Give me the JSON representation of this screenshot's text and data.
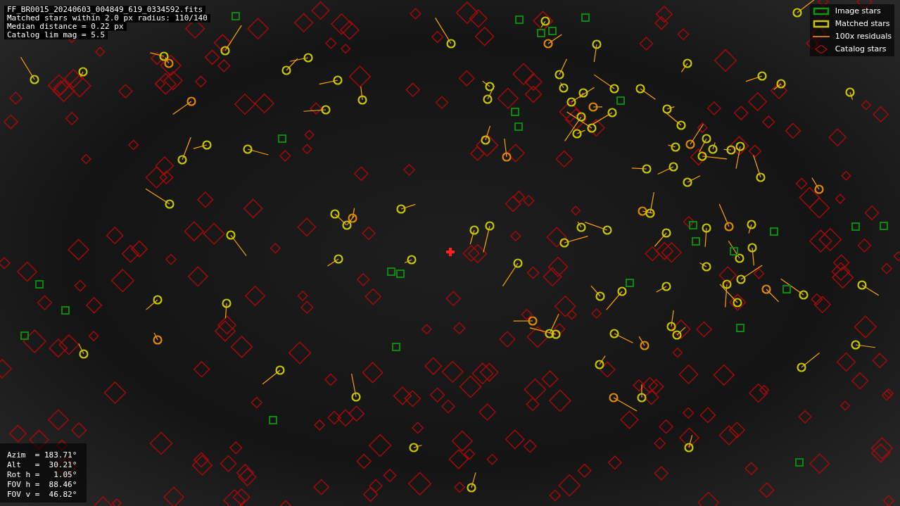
{
  "info": {
    "lines": [
      "FF_BR0015_20240603_004849_619_0334592.fits",
      "Matched stars within 2.0 px radius: 110/140",
      "Median distance = 0.22 px",
      "Catalog lim mag = 5.5"
    ]
  },
  "legend": [
    {
      "kind": "image",
      "label": "Image stars"
    },
    {
      "kind": "matched",
      "label": "Matched stars"
    },
    {
      "kind": "residual",
      "label": "100x residuals"
    },
    {
      "kind": "catalog",
      "label": "Catalog stars"
    }
  ],
  "pointing": {
    "lines": [
      "Azim  = 183.71°",
      "Alt   =  30.21°",
      "Rot h =   1.05°",
      "FOV h =  88.46°",
      "FOV v =  46.82°"
    ]
  }
}
